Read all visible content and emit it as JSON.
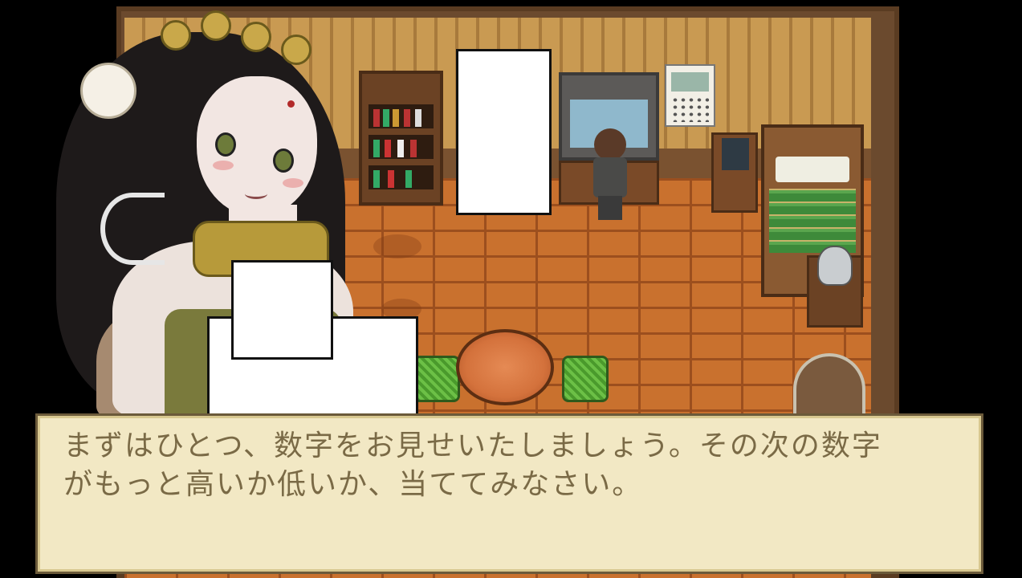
{
  "dialogue": {
    "line1": "まずはひとつ、数字をお見せいたしましょう。その次の数字",
    "line2": "がもっと高いか低いか、当ててみなさい。"
  },
  "colors": {
    "dialogue_bg": "#f2e8c4",
    "dialogue_text": "#7a6a46",
    "floor": "#c9712e",
    "wall": "#c99a52"
  },
  "icons": [
    "bookshelf-icon",
    "tv-icon",
    "calendar-icon",
    "bed-icon",
    "kettle-icon",
    "table-icon",
    "stool-icon",
    "door-icon"
  ]
}
